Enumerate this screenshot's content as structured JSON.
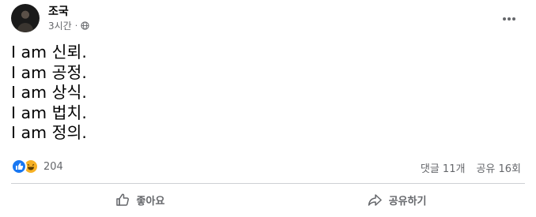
{
  "post": {
    "author": "조국",
    "time": "3시간",
    "separator": "·",
    "audience_icon": "globe-icon",
    "more_icon": "more-horizontal-icon",
    "lines": [
      "I am 신뢰.",
      "I am 공정.",
      "I am 상식.",
      "I am 법치.",
      "I am 정의."
    ]
  },
  "reactions": {
    "icons": [
      "like-reaction-icon",
      "haha-reaction-icon"
    ],
    "count": "204"
  },
  "stats": {
    "comments": "댓글 11개",
    "shares": "공유 16회"
  },
  "actions": {
    "like": "좋아요",
    "share": "공유하기"
  },
  "colors": {
    "text": "#050505",
    "secondary": "#65676b",
    "like_blue": "#1877f2",
    "haha_yellow": "#f7b125",
    "divider": "#ced0d4"
  }
}
